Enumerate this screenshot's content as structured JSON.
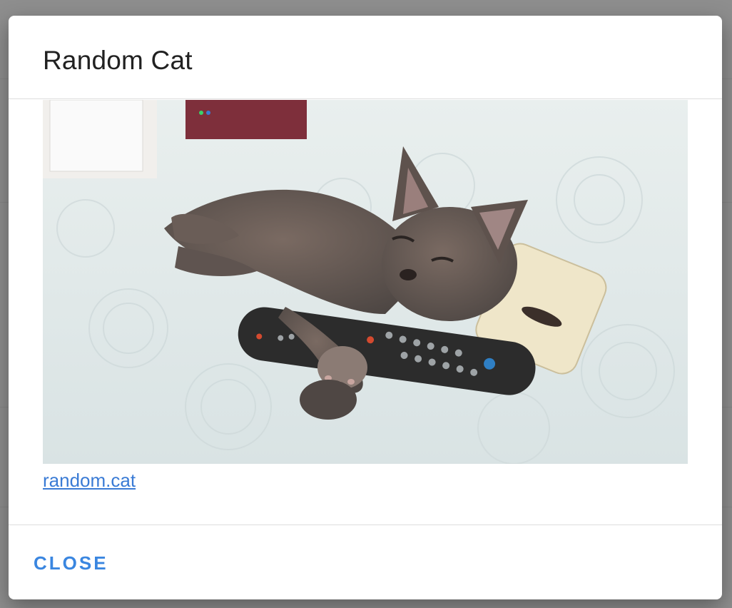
{
  "dialog": {
    "title": "Random Cat",
    "image_alt": "gray kitten hugging a TV remote on a white quilt",
    "link_text": "random.cat",
    "close_label": "CLOSE"
  },
  "colors": {
    "overlay": "#8e8e8e",
    "link": "#3a7bd5",
    "button": "#3a86e0"
  }
}
